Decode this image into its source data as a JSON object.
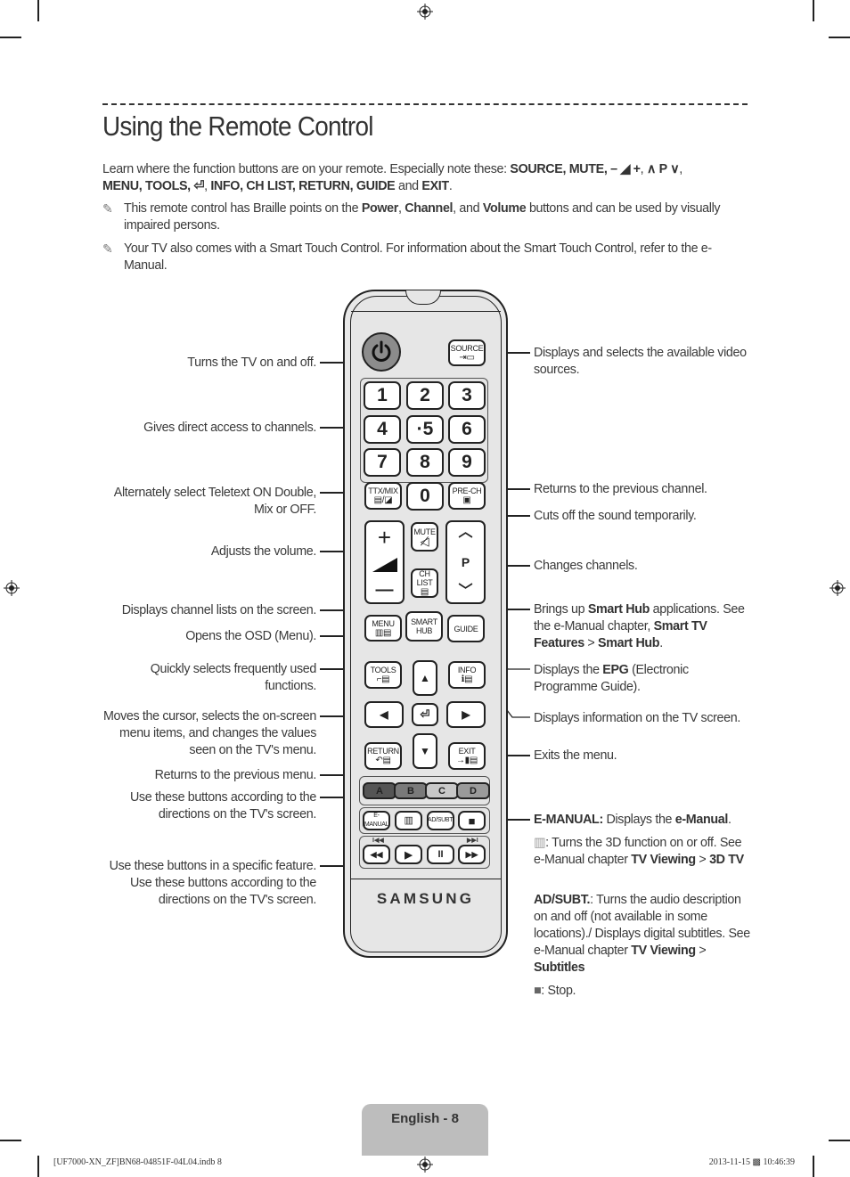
{
  "title": "Using the Remote Control",
  "intro": {
    "lead": "Learn where the function buttons are on your remote. Especially note these: ",
    "keys_line1": "SOURCE, MUTE, ",
    "vol_symbol": "– ◢ +",
    "ch_symbol": "∧ P ∨",
    "keys_line2": "MENU, TOOLS, ",
    "enter_symbol": "⏎",
    "keys_line3": "INFO, CH LIST, RETURN, GUIDE",
    "and": " and ",
    "exit": "EXIT",
    "end": "."
  },
  "notes": [
    {
      "icon": "pencil-note-icon",
      "pre": "This remote control has Braille points on the ",
      "b1": "Power",
      "m1": ", ",
      "b2": "Channel",
      "m2": ", and ",
      "b3": "Volume",
      "post": " buttons and can be used by visually impaired persons."
    },
    {
      "icon": "pencil-note-icon",
      "text": "Your TV also comes with a Smart Touch Control. For information about the Smart Touch Control, refer to the e-Manual."
    }
  ],
  "left_labels": [
    "Turns the TV on and off.",
    "Gives direct access to channels.",
    "Alternately select Teletext ON Double, Mix or OFF.",
    "Adjusts the volume.",
    "Displays channel lists on the screen.",
    "Opens the OSD (Menu).",
    "Quickly selects frequently used functions.",
    "Moves the cursor, selects the on-screen menu items, and changes the values seen on the TV's menu.",
    "Returns to the previous menu.",
    "Use these buttons according to the directions on the TV's screen.",
    "Use these buttons in a specific feature. Use these buttons according to the directions on the TV's screen."
  ],
  "right_labels": {
    "source": "Displays and selects the available video sources.",
    "prech": "Returns to the previous channel.",
    "mute": "Cuts off the sound temporarily.",
    "channel": "Changes channels.",
    "smarthub": {
      "pre": "Brings up ",
      "b1": "Smart Hub",
      "mid": " applications. See the e-Manual chapter, ",
      "b2": "Smart TV Features",
      "gt": " > ",
      "b3": "Smart Hub",
      "end": "."
    },
    "guide": {
      "pre": "Displays the ",
      "b1": "EPG",
      "post": " (Electronic Programme Guide)."
    },
    "info": "Displays information on the TV screen.",
    "exit": "Exits the menu.",
    "emanual": {
      "b1": "E-MANUAL:",
      "mid": " Displays the ",
      "b2": "e-Manual",
      "end": "."
    },
    "threed": {
      "pre": ": Turns the 3D function on or off. See e-Manual chapter ",
      "b1": "TV Viewing",
      "gt": " > ",
      "b2": "3D TV"
    },
    "adsubt": {
      "b1": "AD/SUBT.",
      "mid": ": Turns the audio description on and off (not available in some locations)./ Displays digital subtitles. See e-Manual chapter ",
      "b2": "TV Viewing",
      "gt": " > ",
      "b3": "Subtitles"
    },
    "stop": ": Stop."
  },
  "remote": {
    "source": "SOURCE",
    "digits": [
      "1",
      "2",
      "3",
      "4",
      "·5",
      "6",
      "7",
      "8",
      "9"
    ],
    "zero": "0",
    "ttx": "TTX/MIX",
    "prech": "PRE-CH",
    "vol_plus": "+",
    "vol_minus": "—",
    "mute": "MUTE",
    "chlist": "CH LIST",
    "p": "P",
    "menu": "MENU",
    "smart_hub": "SMART HUB",
    "guide": "GUIDE",
    "tools": "TOOLS",
    "info": "INFO",
    "return": "RETURN",
    "exit": "EXIT",
    "up": "▲",
    "down": "▼",
    "left": "◀",
    "right": "▶",
    "enter": "⏎",
    "colors": [
      {
        "label": "A",
        "color": "#555555"
      },
      {
        "label": "B",
        "color": "#7a7a7a"
      },
      {
        "label": "C",
        "color": "#c8c8c8"
      },
      {
        "label": "D",
        "color": "#9a9a9a"
      }
    ],
    "emanual": "E-MANUAL",
    "adsubt": "AD/SUBT.",
    "stop": "■",
    "rew": "◀◀",
    "play": "▶",
    "pause": "II",
    "ff": "▶▶",
    "prev_track": "I◀◀",
    "next_track": "▶▶I",
    "brand": "SAMSUNG"
  },
  "footer": {
    "page": "English - 8",
    "file": "[UF7000-XN_ZF]BN68-04851F-04L04.indb   8",
    "stamp": "2013-11-15   ▩ 10:46:39"
  }
}
